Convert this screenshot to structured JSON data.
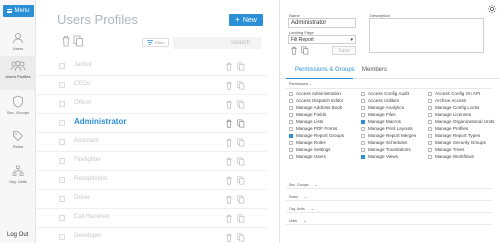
{
  "nav": {
    "menu_label": "Menu",
    "items": [
      {
        "label": "Users",
        "icon": "user-icon",
        "active": false
      },
      {
        "label": "Users Profiles",
        "icon": "users-group-icon",
        "active": true
      },
      {
        "label": "Sec. Groups",
        "icon": "shield-icon",
        "active": false
      },
      {
        "label": "Roles",
        "icon": "tag-icon",
        "active": false
      },
      {
        "label": "Org. Units",
        "icon": "org-chart-icon",
        "active": false
      }
    ],
    "logout_label": "Log Out"
  },
  "list": {
    "title": "Users Profiles",
    "new_label": "New",
    "filter_label": "Filter",
    "search_placeholder": "Search",
    "rows": [
      {
        "name": "Janitor"
      },
      {
        "name": "CEOs"
      },
      {
        "name": "Officer"
      },
      {
        "name": "Administrator"
      },
      {
        "name": "Assistant"
      },
      {
        "name": "Firefighter"
      },
      {
        "name": "Receptionist"
      },
      {
        "name": "Driver"
      },
      {
        "name": "Call Receiver"
      },
      {
        "name": "Developer"
      }
    ],
    "selected_index": 3
  },
  "detail": {
    "name_label": "Name",
    "name_value": "Administrator",
    "description_label": "Description",
    "landing_label": "Landing Page",
    "landing_value": "Fill Report",
    "save_label": "Save",
    "tabs": [
      "Permissions & Groups",
      "Members"
    ],
    "active_tab": 0,
    "permissions_label": "Permissions",
    "permissions_col1": [
      {
        "label": "Access Administration",
        "checked": false
      },
      {
        "label": "Access Dispatch Editor",
        "checked": false
      },
      {
        "label": "Manage Address Book",
        "checked": false
      },
      {
        "label": "Manage Fields",
        "checked": false
      },
      {
        "label": "Manage Lists",
        "checked": false
      },
      {
        "label": "Manage PDF Forms",
        "checked": false
      },
      {
        "label": "Manage Report Groups",
        "checked": true
      },
      {
        "label": "Manage Roles",
        "checked": false
      },
      {
        "label": "Manage Settings",
        "checked": false
      },
      {
        "label": "Manage Users",
        "checked": false
      }
    ],
    "permissions_col2": [
      {
        "label": "Access Config Audit",
        "checked": false
      },
      {
        "label": "Access Utilities",
        "checked": false
      },
      {
        "label": "Manage Analytics",
        "checked": false
      },
      {
        "label": "Manage Files",
        "checked": false
      },
      {
        "label": "Manage Macros",
        "checked": true
      },
      {
        "label": "Manage Print Layouts",
        "checked": false
      },
      {
        "label": "Manage Report Merges",
        "checked": false
      },
      {
        "label": "Manage Schedules",
        "checked": false
      },
      {
        "label": "Manage Translations",
        "checked": false
      },
      {
        "label": "Manage Views",
        "checked": true
      }
    ],
    "permissions_col3": [
      {
        "label": "Access Config On API",
        "checked": false
      },
      {
        "label": "Archive Access",
        "checked": false
      },
      {
        "label": "Manage Config Locks",
        "checked": false
      },
      {
        "label": "Manage Licenses",
        "checked": false
      },
      {
        "label": "Manage Organizational Units",
        "checked": false
      },
      {
        "label": "Manage Profiles",
        "checked": false
      },
      {
        "label": "Manage Report Types",
        "checked": false
      },
      {
        "label": "Manage Security Groups",
        "checked": false
      },
      {
        "label": "Manage Trees",
        "checked": false
      },
      {
        "label": "Manage Workflows",
        "checked": false
      }
    ],
    "collapsibles": [
      "Sec. Groups",
      "Roles",
      "Org. Units",
      "Units"
    ]
  },
  "colors": {
    "accent": "#2b8fd6",
    "title": "#aeb7c0"
  }
}
